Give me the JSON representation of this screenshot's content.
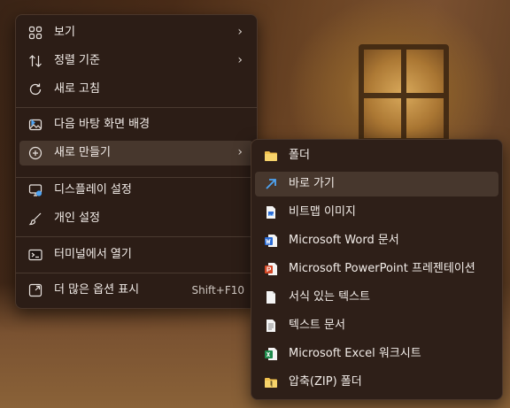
{
  "main_menu": {
    "items": [
      {
        "label": "보기",
        "icon": "grid-icon"
      },
      {
        "label": "정렬 기준",
        "icon": "sort-icon"
      },
      {
        "label": "새로 고침",
        "icon": "refresh-icon"
      },
      {
        "label": "다음 바탕 화면 배경",
        "icon": "next-wallpaper-icon"
      },
      {
        "label": "새로 만들기",
        "icon": "new-plus-icon"
      },
      {
        "label": "디스플레이 설정",
        "icon": "display-icon"
      },
      {
        "label": "개인 설정",
        "icon": "brush-icon"
      },
      {
        "label": "터미널에서 열기",
        "icon": "terminal-icon"
      },
      {
        "label": "더 많은 옵션 표시",
        "icon": "more-options-icon",
        "shortcut": "Shift+F10"
      }
    ]
  },
  "submenu": {
    "items": [
      {
        "label": "폴더",
        "icon": "folder-icon"
      },
      {
        "label": "바로 가기",
        "icon": "shortcut-arrow-icon"
      },
      {
        "label": "비트맵 이미지",
        "icon": "bitmap-icon"
      },
      {
        "label": "Microsoft Word 문서",
        "icon": "word-icon"
      },
      {
        "label": "Microsoft PowerPoint 프레젠테이션",
        "icon": "powerpoint-icon"
      },
      {
        "label": "서식 있는 텍스트",
        "icon": "rich-text-icon"
      },
      {
        "label": "텍스트 문서",
        "icon": "text-document-icon"
      },
      {
        "label": "Microsoft Excel 워크시트",
        "icon": "excel-icon"
      },
      {
        "label": "압축(ZIP) 폴더",
        "icon": "zip-folder-icon"
      }
    ]
  },
  "colors": {
    "menu_bg": "#2c1d16",
    "hover_bg": "#47372d",
    "word_blue": "#2b6cd6",
    "ppt_orange": "#d24726",
    "excel_green": "#1f8a4c",
    "folder_yellow": "#f2c14e",
    "shortcut_blue": "#4ea3f2"
  }
}
